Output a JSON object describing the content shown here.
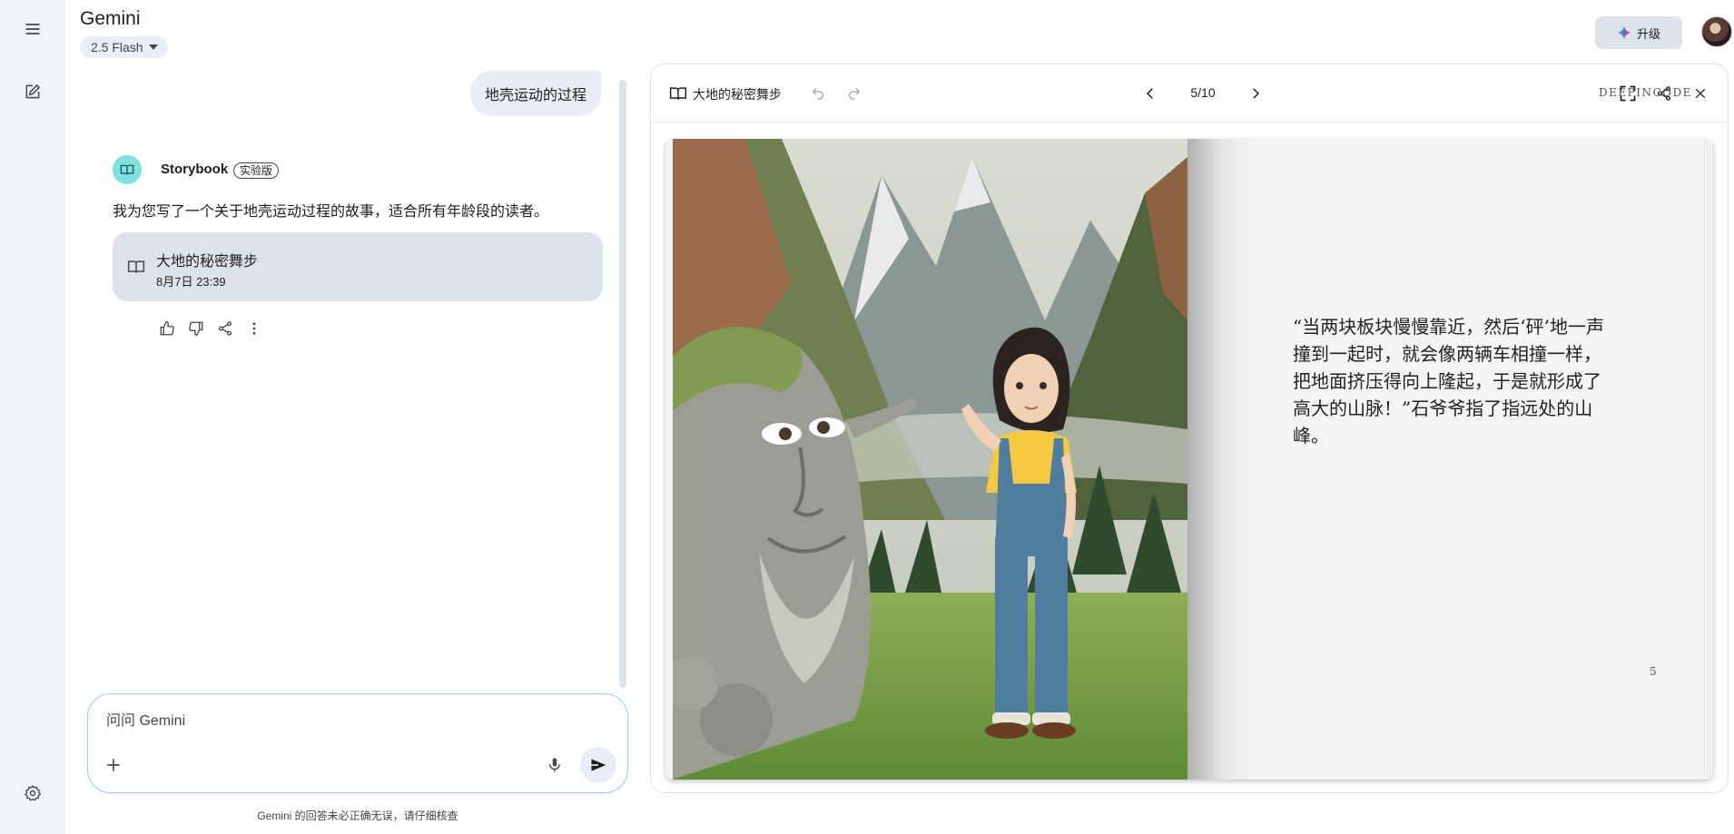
{
  "app": {
    "title": "Gemini",
    "model": "2.5 Flash"
  },
  "header": {
    "upgrade_label": "升级"
  },
  "chat": {
    "user_message": "地壳运动的过程",
    "assistant": {
      "name": "Storybook",
      "badge": "实验版",
      "text": "我为您写了一个关于地壳运动过程的故事，适合所有年龄段的读者。",
      "card": {
        "title": "大地的秘密舞步",
        "date": "8月7日 23:39"
      }
    }
  },
  "composer": {
    "placeholder": "问问 Gemini"
  },
  "disclaimer": "Gemini 的回答未必正确无误，请仔细核查",
  "panel": {
    "title": "大地的秘密舞步",
    "page_indicator": "5/10",
    "brand": "DEEPINCODE",
    "story_text": "“当两块板块慢慢靠近，然后‘砰’地一声撞到一起时，就会像两辆车相撞一样，把地面挤压得向上隆起，于是就形成了高大的山脉！”石爷爷指了指远处的山峰。",
    "page_number": "5"
  },
  "icons": {
    "menu": "menu-icon",
    "new_chat": "edit-icon",
    "settings": "gear-icon",
    "upgrade": "sparkle-icon",
    "book": "book-icon",
    "like": "thumbs-up-icon",
    "dislike": "thumbs-down-icon",
    "share": "share-icon",
    "more": "more-vert-icon",
    "add": "plus-icon",
    "mic": "mic-icon",
    "send": "send-icon",
    "undo": "undo-icon",
    "redo": "redo-icon",
    "prev": "chevron-left-icon",
    "next": "chevron-right-icon",
    "fullscreen": "fullscreen-icon",
    "close": "close-icon"
  },
  "colors": {
    "rail_bg": "#f0f4f9",
    "bubble_bg": "#e9eef6",
    "card_bg": "#dde3ea",
    "storybook_avatar": "#7ee0df"
  }
}
